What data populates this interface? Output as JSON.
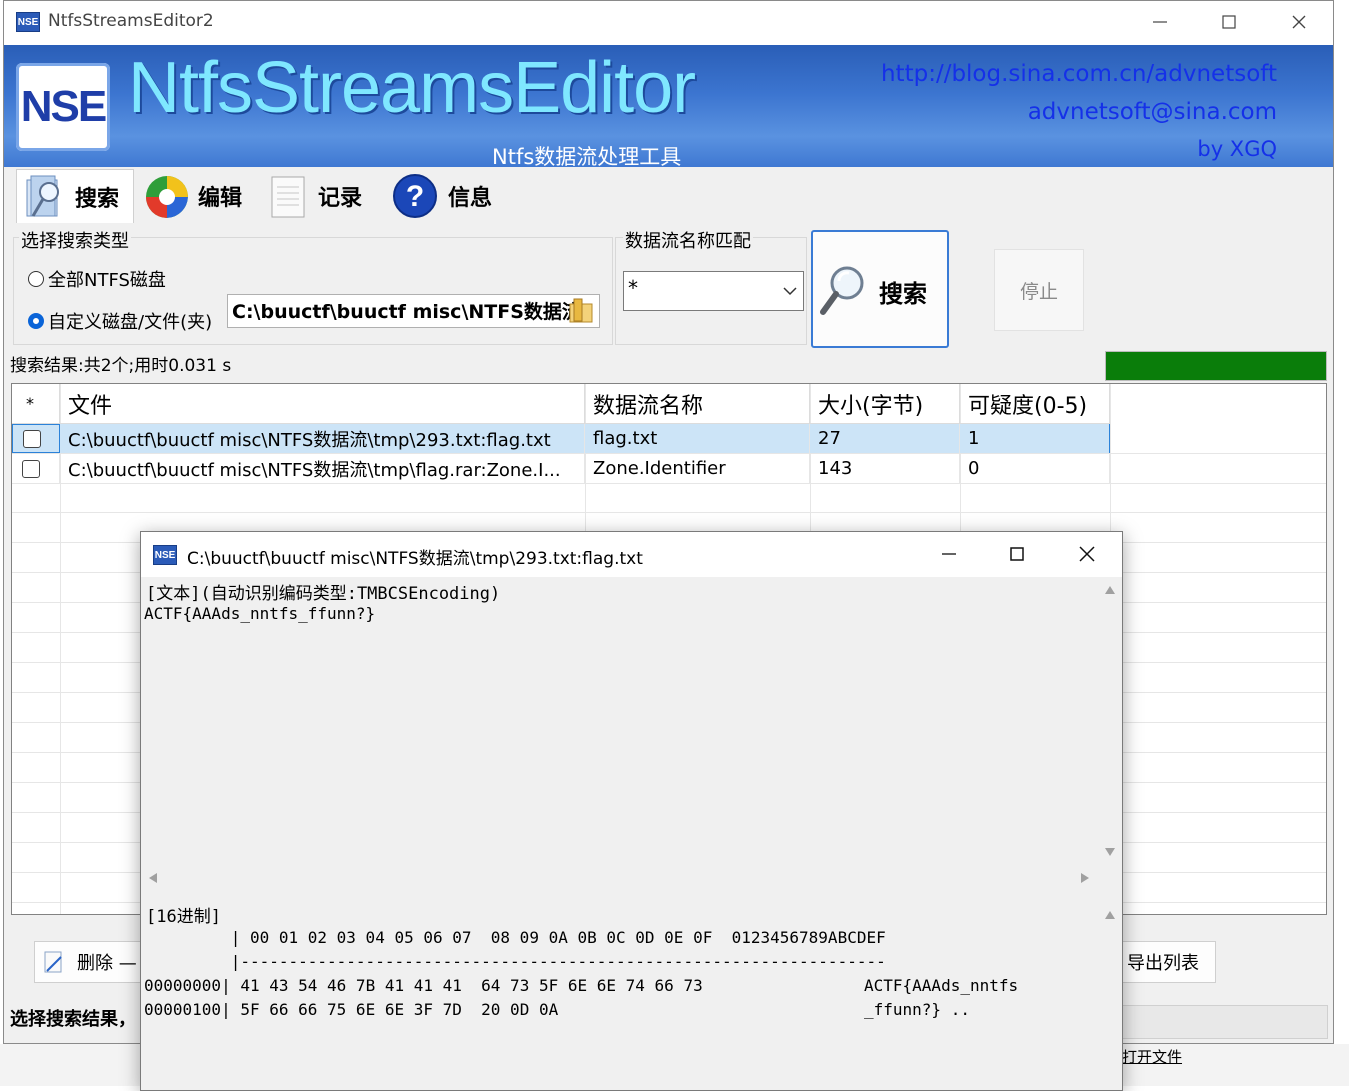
{
  "main_window": {
    "title": "NtfsStreamsEditor2",
    "banner": {
      "logo_text": "NSE",
      "title": "NtfsStreamsEditor",
      "subtitle": "Ntfs数据流处理工具",
      "link_blog": "http://blog.sina.com.cn/advnetsoft",
      "link_email": "advnetsoft@sina.com",
      "author": "by XGQ"
    },
    "toolbar": [
      {
        "label": "搜索",
        "icon": "search-tool-icon"
      },
      {
        "label": "编辑",
        "icon": "edit-tool-icon"
      },
      {
        "label": "记录",
        "icon": "record-tool-icon"
      },
      {
        "label": "信息",
        "icon": "info-tool-icon"
      }
    ],
    "search_type": {
      "group_label": "选择搜索类型",
      "option_all": "全部NTFS磁盘",
      "option_custom": "自定义磁盘/文件(夹)",
      "selected": "custom",
      "path_value": "C:\\buuctf\\buuctf misc\\NTFS数据流"
    },
    "stream_match": {
      "group_label": "数据流名称匹配",
      "value": "*"
    },
    "search_button_label": "搜索",
    "stop_button_label": "停止",
    "status_text": "搜索结果:共2个;用时0.031 s",
    "progress": 1.0,
    "progress_color": "#0a7d0a",
    "table": {
      "columns": [
        "*",
        "文件",
        "数据流名称",
        "大小(字节)",
        "可疑度(0-5)"
      ],
      "rows": [
        {
          "file": "C:\\buuctf\\buuctf misc\\NTFS数据流\\tmp\\293.txt:flag.txt",
          "stream": "flag.txt",
          "size": "27",
          "suspicion": "1",
          "selected": true
        },
        {
          "file": "C:\\buuctf\\buuctf misc\\NTFS数据流\\tmp\\flag.rar:Zone.I...",
          "stream": "Zone.Identifier",
          "size": "143",
          "suspicion": "0",
          "selected": false
        }
      ]
    },
    "delete_button_label": "删除 —",
    "export_button_label": "导出列表",
    "bottom_hint": "选择搜索结果，",
    "open_file_link": "打开文件"
  },
  "popup": {
    "title": "C:\\buuctf\\buuctf misc\\NTFS数据流\\tmp\\293.txt:flag.txt",
    "text_header": "[文本](自动识别编码类型:TMBCSEncoding)",
    "text_content": "ACTF{AAAds_nntfs_ffunn?}",
    "hex_header": "[16进制]",
    "hex_column_header": "         | 00 01 02 03 04 05 06 07  08 09 0A 0B 0C 0D 0E 0F  0123456789ABCDEF",
    "hex_separator": "         |-------------------------------------------------------------------",
    "hex_rows": [
      {
        "offset": "00000000|",
        "bytes": " 41 43 54 46 7B 41 41 41  64 73 5F 6E 6E 74 66 73",
        "ascii": "ACTF{AAAds_nntfs"
      },
      {
        "offset": "00000100|",
        "bytes": " 5F 66 66 75 6E 6E 3F 7D  20 0D 0A",
        "ascii": "_ffunn?} .."
      }
    ]
  }
}
